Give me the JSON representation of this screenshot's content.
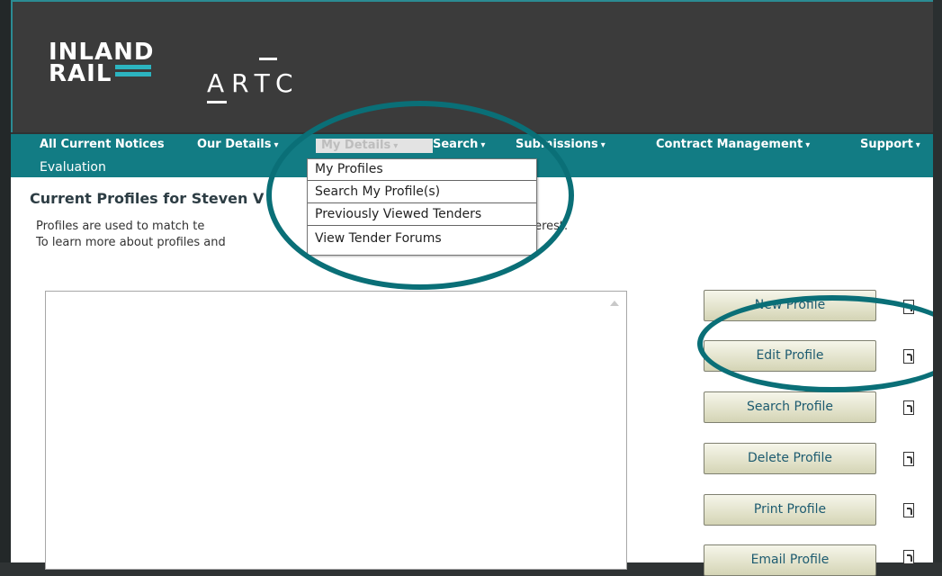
{
  "brand": {
    "inland_line1": "INLAND",
    "inland_line2": "RAIL",
    "artc": "ARTC"
  },
  "nav": {
    "items": [
      {
        "label": "All Current Notices",
        "caret": ""
      },
      {
        "label": "Our Details",
        "caret": "▾"
      },
      {
        "label": "My Details",
        "caret": "▾"
      },
      {
        "label": "Search",
        "caret": "▾"
      },
      {
        "label": "Submissions",
        "caret": "▾"
      },
      {
        "label": "Contract Management",
        "caret": "▾"
      },
      {
        "label": "Support",
        "caret": "▾"
      }
    ],
    "second_row": "Evaluation"
  },
  "dropdown": {
    "items": [
      "My Profiles",
      "Search My Profile(s)",
      "Previously Viewed Tenders",
      "View Tender Forums"
    ]
  },
  "page": {
    "title": "Current Profiles for Steven V",
    "desc_line1_start": "Profiles are used to match te",
    "desc_line1_end": "terest.",
    "desc_line2": "To learn more about profiles and"
  },
  "buttons": [
    {
      "label": "New Profile"
    },
    {
      "label": "Edit Profile"
    },
    {
      "label": "Search Profile"
    },
    {
      "label": "Delete Profile"
    },
    {
      "label": "Print Profile"
    },
    {
      "label": "Email Profile"
    }
  ],
  "colors": {
    "header_bg": "#3b3b3b",
    "nav_bg": "#127c84",
    "accent": "#0a6f77",
    "logo_bar": "#2cb4c0"
  }
}
